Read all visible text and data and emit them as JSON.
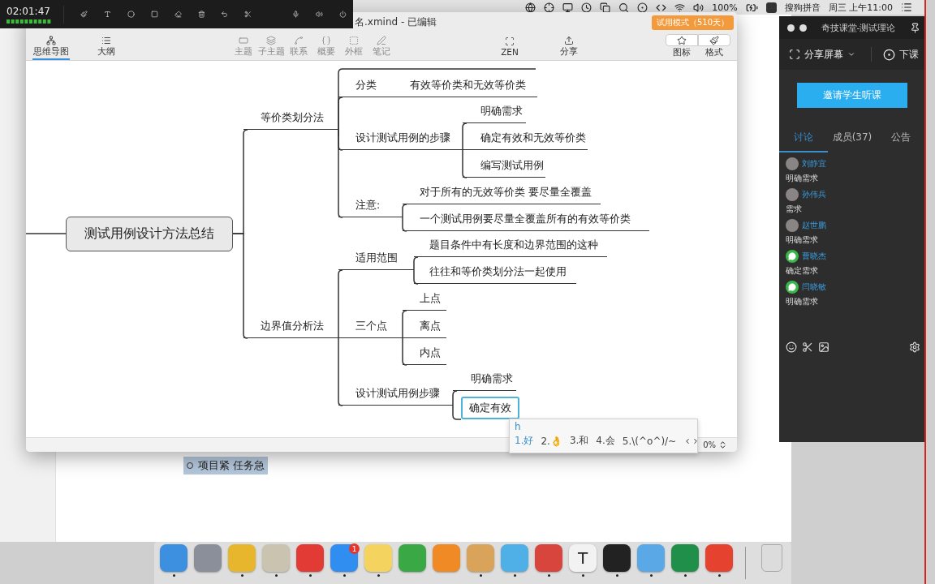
{
  "menubar": {
    "battery": "100%",
    "input_method": "搜狗拼音",
    "clock": "周三 上午11:00"
  },
  "recorder": {
    "time": "02:01:47"
  },
  "document": {
    "bullet_text": "项目紧 任务急"
  },
  "xmind": {
    "title": "名.xmind - 已编辑",
    "trial_badge": "试用模式（510天）",
    "toolbar": [
      {
        "label": "思维导图",
        "kind": "view",
        "selected": true
      },
      {
        "label": "大纲",
        "kind": "view",
        "selected": false
      },
      {
        "label": "主题",
        "kind": "tool",
        "disabled": true
      },
      {
        "label": "子主题",
        "kind": "tool",
        "disabled": true
      },
      {
        "label": "联系",
        "kind": "tool",
        "disabled": true
      },
      {
        "label": "概要",
        "kind": "tool",
        "disabled": true
      },
      {
        "label": "外框",
        "kind": "tool",
        "disabled": true
      },
      {
        "label": "笔记",
        "kind": "tool",
        "disabled": true
      },
      {
        "label": "ZEN",
        "kind": "tool",
        "disabled": false
      },
      {
        "label": "分享",
        "kind": "tool",
        "disabled": false
      },
      {
        "label": "图标",
        "kind": "panel"
      },
      {
        "label": "格式",
        "kind": "panel"
      }
    ],
    "map": {
      "root": "测试用例设计方法总结",
      "children": [
        {
          "label": "等价类划分法",
          "editing": false,
          "children": [
            {
              "label": "分类",
              "editing": false,
              "children": [
                {
                  "label": "有效等价类和无效等价类",
                  "editing": false
                }
              ]
            },
            {
              "label": "设计测试用例的步骤",
              "editing": false,
              "children": [
                {
                  "label": "明确需求",
                  "editing": false
                },
                {
                  "label": "确定有效和无效等价类",
                  "editing": false
                },
                {
                  "label": "编写测试用例",
                  "editing": false
                }
              ]
            },
            {
              "label": "注意:",
              "editing": false,
              "children": [
                {
                  "label": "对于所有的无效等价类 要尽量全覆盖",
                  "editing": false
                },
                {
                  "label": "一个测试用例要尽量全覆盖所有的有效等价类",
                  "editing": false
                }
              ]
            }
          ]
        },
        {
          "label": "边界值分析法",
          "editing": false,
          "children": [
            {
              "label": "适用范围",
              "editing": false,
              "children": [
                {
                  "label": "题目条件中有长度和边界范围的这种",
                  "editing": false
                },
                {
                  "label": "往往和等价类划分法一起使用",
                  "editing": false
                }
              ]
            },
            {
              "label": "三个点",
              "editing": false,
              "children": [
                {
                  "label": "上点",
                  "editing": false
                },
                {
                  "label": "离点",
                  "editing": false
                },
                {
                  "label": "内点",
                  "editing": false
                }
              ]
            },
            {
              "label": "设计测试用例步骤",
              "editing": false,
              "children": [
                {
                  "label": "明确需求",
                  "editing": false
                },
                {
                  "label": "确定有效",
                  "editing": true
                }
              ]
            }
          ]
        }
      ]
    },
    "zoom": "0%"
  },
  "ime": {
    "input": "h",
    "candidates": [
      {
        "label": "1.好",
        "selected": true
      },
      {
        "label": "2.👌",
        "selected": false
      },
      {
        "label": "3.和",
        "selected": false
      },
      {
        "label": "4.会",
        "selected": false
      },
      {
        "label": "5.\\(^o^)/~",
        "selected": false
      }
    ]
  },
  "classroom": {
    "title": "奇技课堂-测试理论",
    "share": "分享屏幕",
    "end": "下课",
    "invite": "邀请学生听课",
    "tabs": [
      {
        "label": "讨论",
        "selected": true
      },
      {
        "label": "成员(37)",
        "selected": false
      },
      {
        "label": "公告",
        "selected": false
      }
    ],
    "messages": [
      {
        "name": "刘静宜",
        "text": "明确需求",
        "kind": "photo"
      },
      {
        "name": "孙伟兵",
        "text": "需求",
        "kind": "photo"
      },
      {
        "name": "赵世鹏",
        "text": "明确需求",
        "kind": "photo"
      },
      {
        "name": "曹晓杰",
        "text": "确定需求",
        "kind": "wechat"
      },
      {
        "name": "闫晓敏",
        "text": "明确需求",
        "kind": "wechat"
      }
    ]
  },
  "dock": [
    {
      "kind": "app",
      "color": "#3d8fe0",
      "running": true
    },
    {
      "kind": "app",
      "color": "#8a8f99",
      "running": false
    },
    {
      "kind": "app",
      "color": "#e8b62c",
      "running": true
    },
    {
      "kind": "app",
      "color": "#c9c3b0",
      "running": true
    },
    {
      "kind": "app",
      "color": "#e23b35",
      "running": true
    },
    {
      "kind": "app",
      "color": "#2f8ef0",
      "running": true,
      "badge": "1"
    },
    {
      "kind": "app",
      "color": "#f4d35e",
      "running": true
    },
    {
      "kind": "app",
      "color": "#3ba846",
      "running": false
    },
    {
      "kind": "app",
      "color": "#ef8a24",
      "running": false
    },
    {
      "kind": "app",
      "color": "#d9a35a",
      "running": true
    },
    {
      "kind": "app",
      "color": "#4fb0e8",
      "running": true
    },
    {
      "kind": "app",
      "color": "#d8453c",
      "running": true
    },
    {
      "kind": "app",
      "color": "#f2f2f2",
      "running": true,
      "letter": "T"
    },
    {
      "kind": "app",
      "color": "#222222",
      "running": true
    },
    {
      "kind": "app",
      "color": "#5aa8e6",
      "running": true
    },
    {
      "kind": "app",
      "color": "#1f8f4a",
      "running": true
    },
    {
      "kind": "app",
      "color": "#e5432f",
      "running": true
    },
    {
      "kind": "trash",
      "color": "#dcdcdc",
      "running": false
    }
  ]
}
